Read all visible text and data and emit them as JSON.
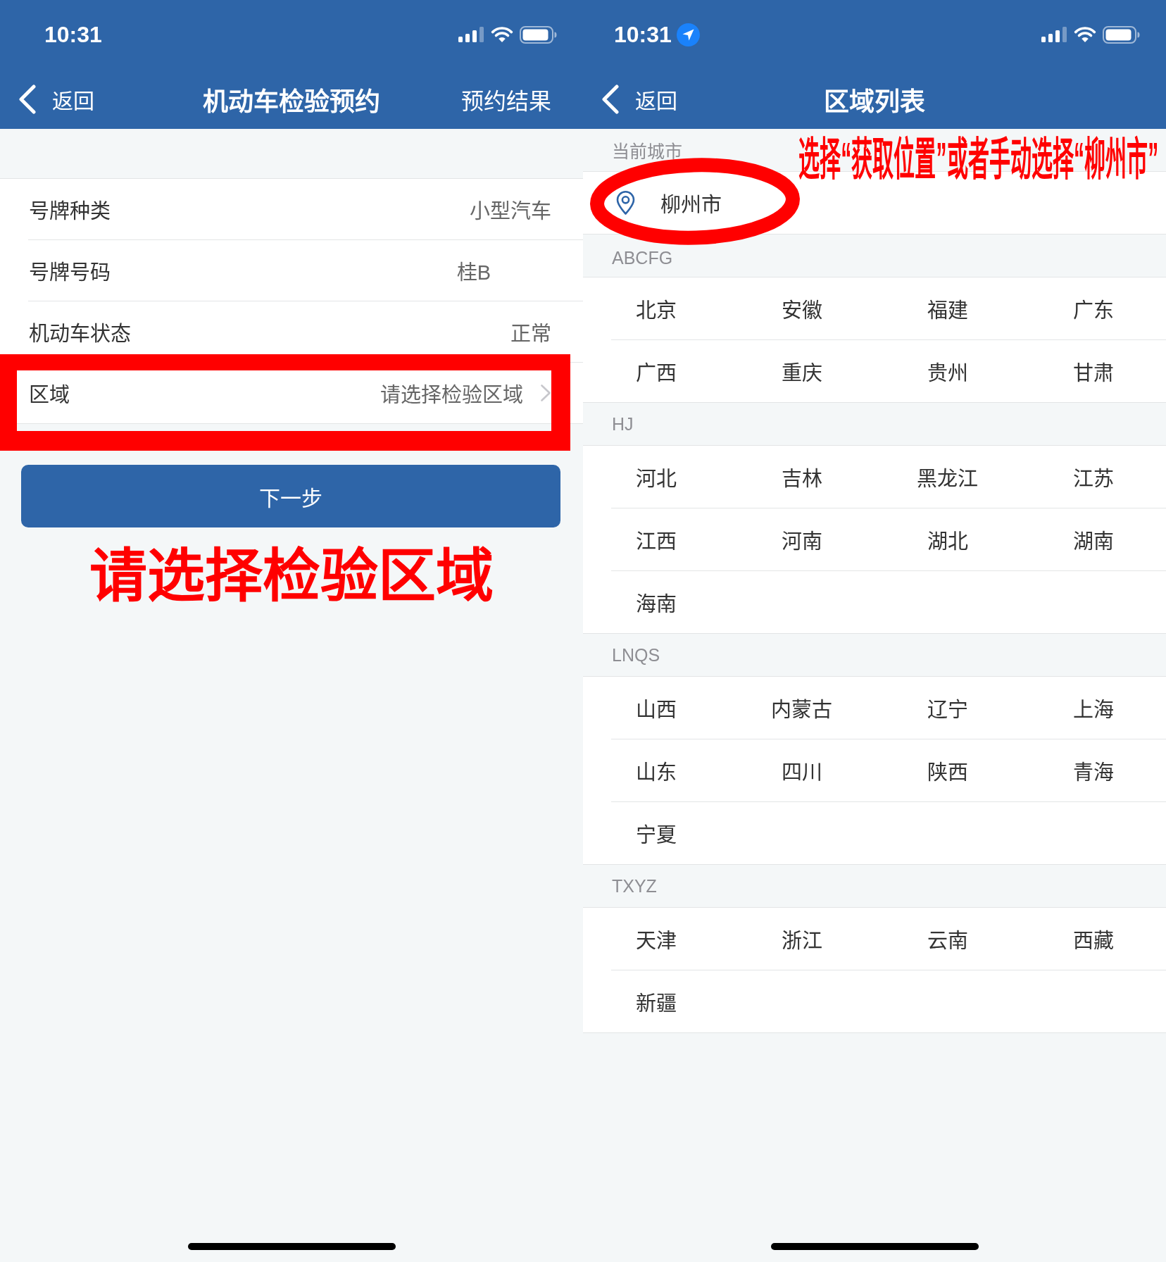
{
  "left_screen": {
    "status_bar": {
      "time": "10:31"
    },
    "nav_bar": {
      "back": "返回",
      "title": "机动车检验预约",
      "action": "预约结果"
    },
    "form_rows": [
      {
        "label": "号牌种类",
        "value": "小型汽车",
        "kind": "text"
      },
      {
        "label": "号牌号码",
        "value": "桂B",
        "kind": "plate"
      },
      {
        "label": "机动车状态",
        "value": "正常",
        "kind": "text"
      },
      {
        "label": "区域",
        "value": "请选择检验区域",
        "kind": "select"
      }
    ],
    "next_button": "下一步",
    "instruction": "请选择检验区域"
  },
  "right_screen": {
    "status_bar": {
      "time": "10:31",
      "location_active": true
    },
    "nav_bar": {
      "back": "返回",
      "title": "区域列表"
    },
    "instruction": "选择“获取位置”或者手动选择“柳州市”",
    "current_city": {
      "header": "当前城市",
      "city": "柳州市"
    },
    "sections": [
      {
        "header": "ABCFG",
        "items": [
          "北京",
          "安徽",
          "福建",
          "广东",
          "广西",
          "重庆",
          "贵州",
          "甘肃"
        ]
      },
      {
        "header": "HJ",
        "items": [
          "河北",
          "吉林",
          "黑龙江",
          "江苏",
          "江西",
          "河南",
          "湖北",
          "湖南",
          "海南"
        ]
      },
      {
        "header": "LNQS",
        "items": [
          "山西",
          "内蒙古",
          "辽宁",
          "上海",
          "山东",
          "四川",
          "陕西",
          "青海",
          "宁夏"
        ]
      },
      {
        "header": "TXYZ",
        "items": [
          "天津",
          "浙江",
          "云南",
          "西藏",
          "新疆"
        ]
      }
    ]
  }
}
